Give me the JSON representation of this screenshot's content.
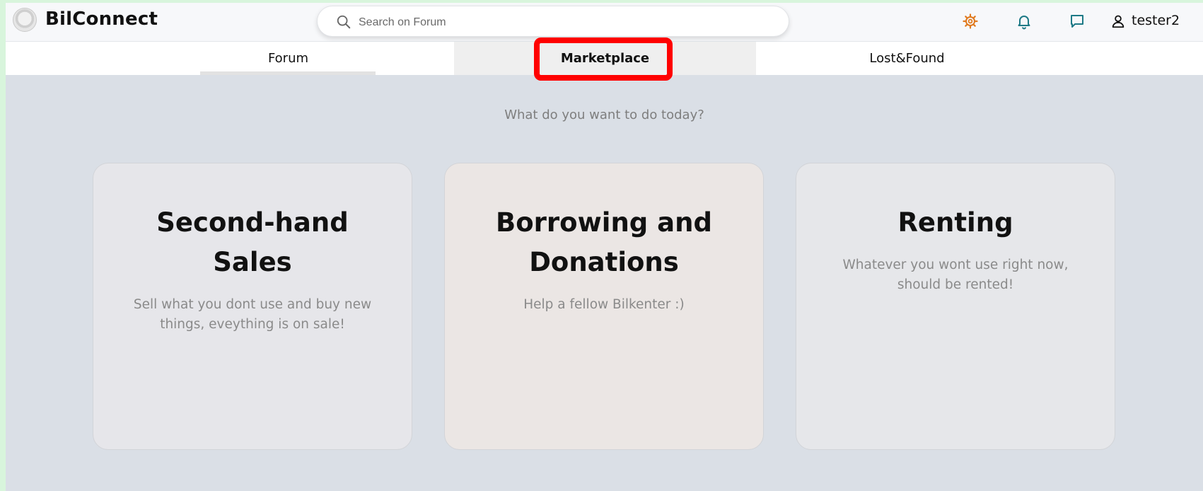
{
  "header": {
    "brand": "BilConnect",
    "search": {
      "placeholder": "Search on Forum",
      "value": ""
    },
    "user": {
      "name": "tester2"
    },
    "icons": [
      "settings-gear-icon",
      "bell-icon",
      "chat-bubble-icon",
      "user-icon"
    ],
    "colors": {
      "gear": "#e07a1f",
      "accent": "#1e7a86"
    }
  },
  "tabs": [
    {
      "label": "Forum",
      "active": false
    },
    {
      "label": "Marketplace",
      "active": true
    },
    {
      "label": "Lost&Found",
      "active": false
    }
  ],
  "main": {
    "prompt": "What do you want to do today?",
    "cards": [
      {
        "title_line1": "Second-hand",
        "title_line2": "Sales",
        "description_line1": "Sell what you dont use and buy new",
        "description_line2": "things, eveything is on sale!",
        "color": "#e6e6ea"
      },
      {
        "title_line1": "Borrowing and",
        "title_line2": "Donations",
        "description_line1": "Help a fellow Bilkenter :)",
        "color": "#ebe6e4"
      },
      {
        "title_line1": "Renting",
        "description_line1": "Whatever you wont use right now,",
        "description_line2": "should be rented!",
        "color": "#e6e7ea"
      }
    ]
  },
  "annotation": {
    "highlight_color": "#ff0000"
  }
}
